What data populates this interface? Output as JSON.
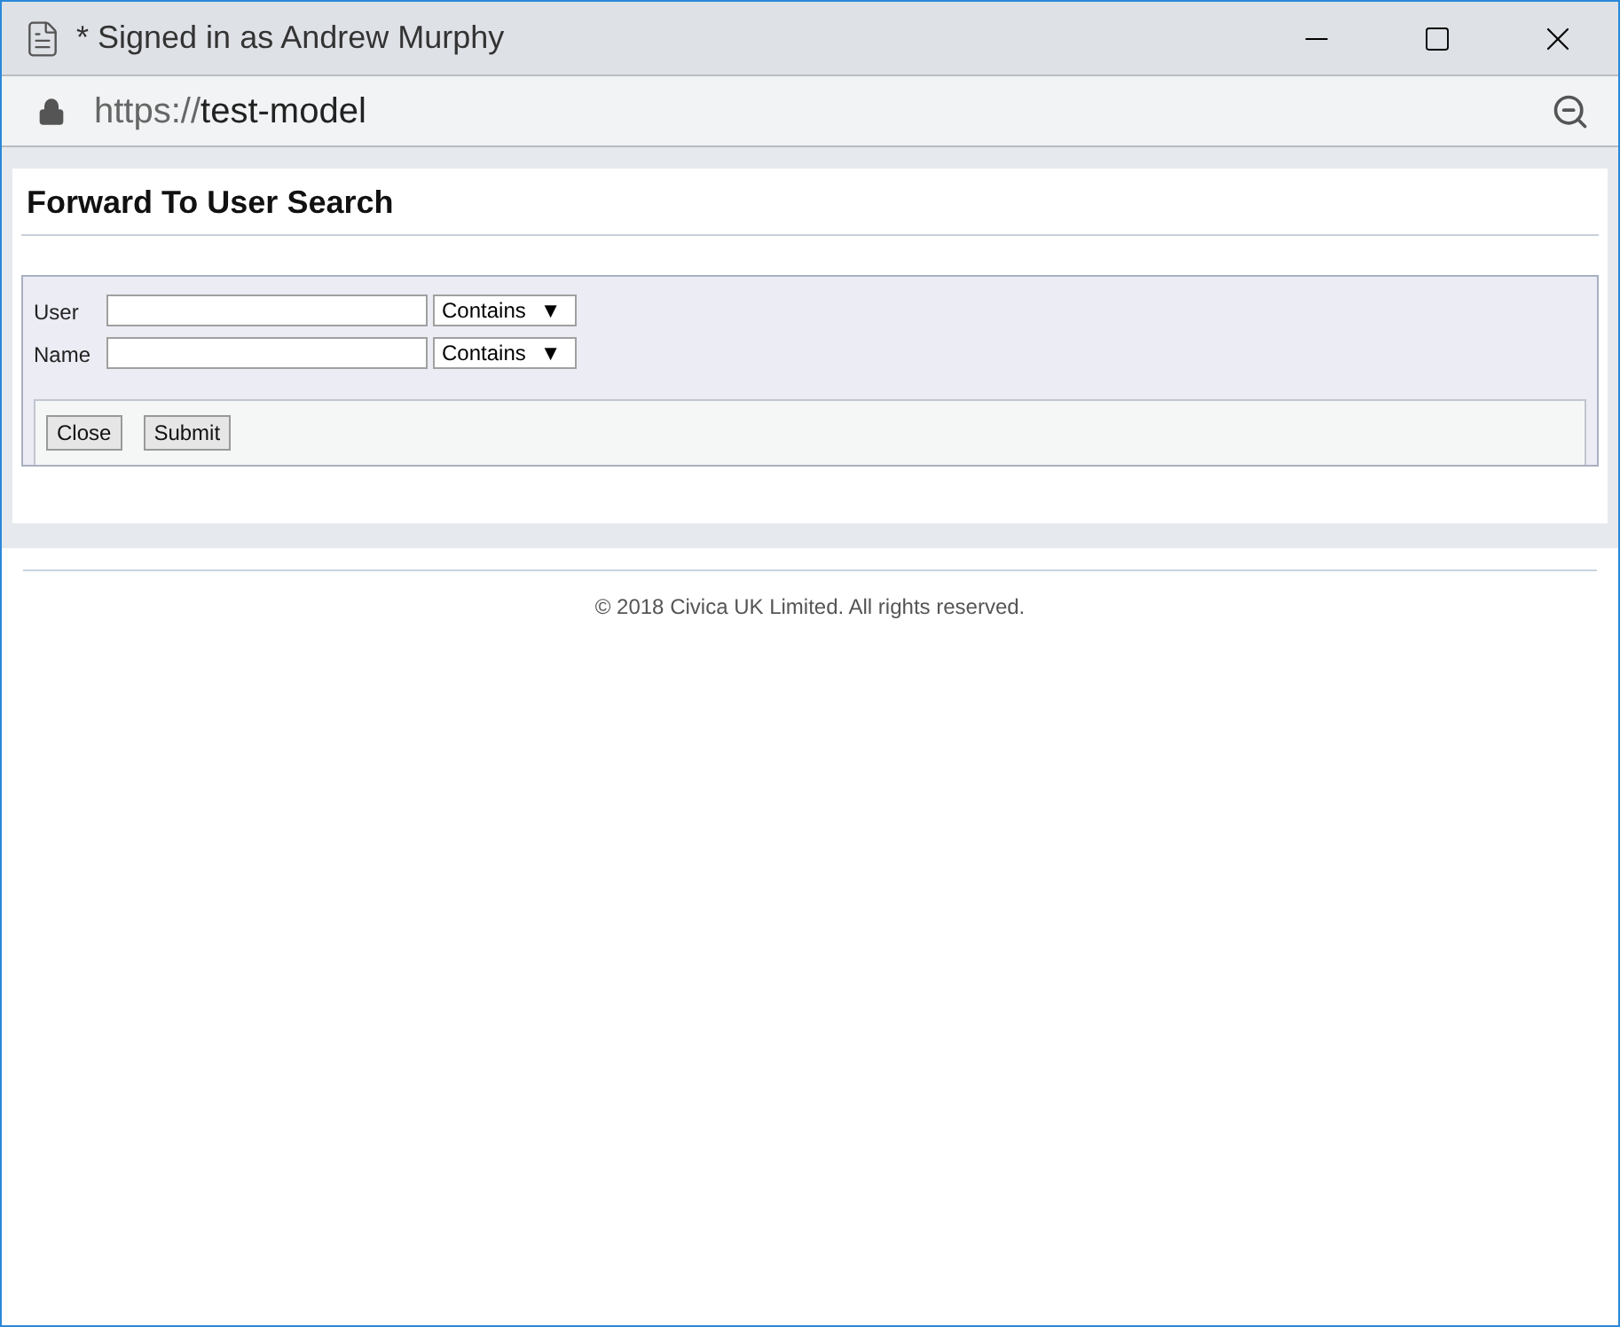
{
  "window": {
    "title": "* Signed in as Andrew Murphy"
  },
  "address_bar": {
    "scheme": "https://",
    "host": "test-model"
  },
  "page": {
    "heading": "Forward To User Search",
    "fields": [
      {
        "label": "User",
        "operator": "Contains",
        "arrow": "▼"
      },
      {
        "label": "Name",
        "operator": "Contains",
        "arrow": "▼"
      }
    ],
    "buttons": [
      "Close",
      "Submit"
    ]
  },
  "footer": "© 2018 Civica UK Limited. All rights reserved."
}
